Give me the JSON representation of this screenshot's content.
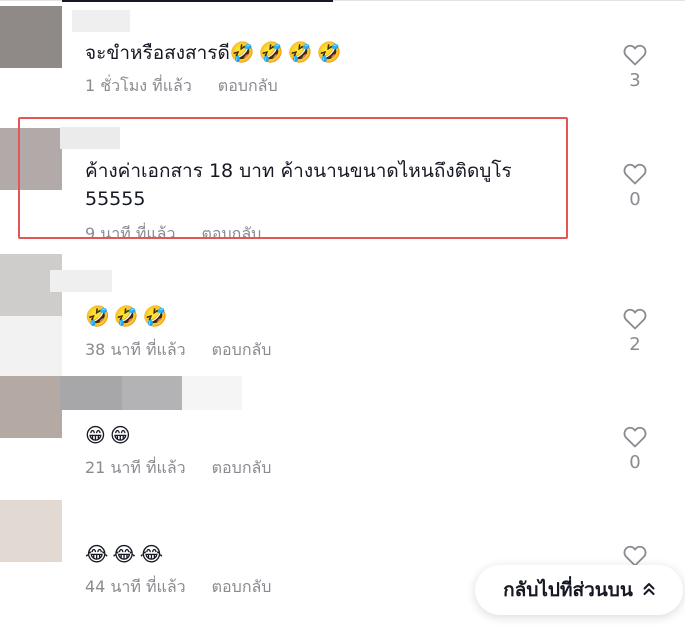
{
  "comments": [
    {
      "text": "จะขำหรือสงสารดี",
      "emoji": "🤣🤣🤣🤣",
      "time": "1 ชั่วโมง ที่แล้ว",
      "reply": "ตอบกลับ",
      "likes": "3"
    },
    {
      "text": "ค้างค่าเอกสาร 18 บาท ค้างนานขนาดไหนถึงติดบูโร 55555",
      "emoji": "",
      "time": "9 นาที ที่แล้ว",
      "reply": "ตอบกลับ",
      "likes": "0"
    },
    {
      "text": "",
      "emoji": "🤣🤣🤣",
      "time": "38 นาที ที่แล้ว",
      "reply": "ตอบกลับ",
      "likes": "2"
    },
    {
      "text": "",
      "emoji": "😁😁",
      "time": "21 นาที ที่แล้ว",
      "reply": "ตอบกลับ",
      "likes": "0"
    },
    {
      "text": "",
      "emoji": "😂😂😂",
      "time": "44 นาที ที่แล้ว",
      "reply": "ตอบกลับ",
      "likes": ""
    }
  ],
  "back_to_top": {
    "label": "กลับไปที่ส่วนบน",
    "icon": "double-chevron-up-icon"
  },
  "colors": {
    "highlight": "#e35656",
    "muted": "#8a8b91",
    "text": "#161823"
  }
}
